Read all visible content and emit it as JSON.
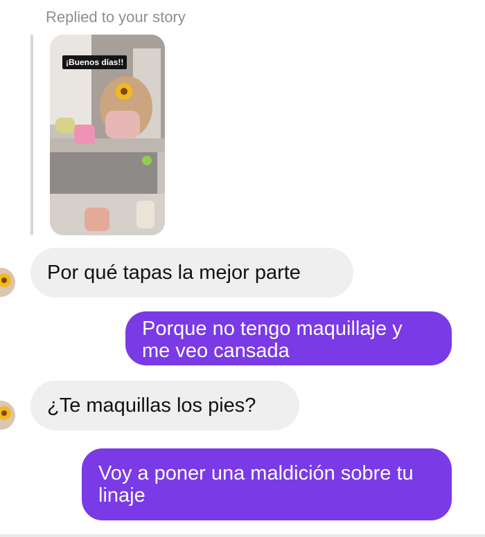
{
  "colors": {
    "incoming_bubble": "#efefef",
    "outgoing_bubble": "#7a3ae6",
    "meta_text": "#8e8e8e"
  },
  "story_reply": {
    "label": "Replied to your story",
    "thumbnail_caption": "¡Buenos días!!"
  },
  "messages": [
    {
      "direction": "incoming",
      "text": "Por qué tapas la mejor parte"
    },
    {
      "direction": "outgoing",
      "text": "Porque no tengo maquillaje y me veo cansada"
    },
    {
      "direction": "incoming",
      "text": "¿Te maquillas los pies?"
    },
    {
      "direction": "outgoing",
      "text": "Voy a poner una maldición sobre tu linaje"
    }
  ]
}
